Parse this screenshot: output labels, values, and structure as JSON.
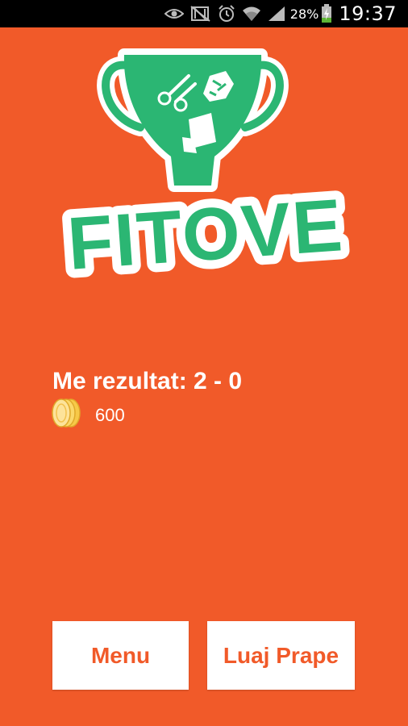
{
  "status_bar": {
    "battery_percent": "28%",
    "time": "19:37",
    "icons": [
      "eye-icon",
      "nfc-off-icon",
      "alarm-icon",
      "wifi-icon",
      "signal-icon",
      "battery-charging-icon"
    ]
  },
  "logo": {
    "text": "FITOVE",
    "colors": {
      "green": "#2bb673",
      "white": "#ffffff",
      "background": "#f15a29"
    },
    "icons": [
      "trophy-icon",
      "scissors-icon",
      "rock-icon",
      "paper-icon"
    ]
  },
  "result": {
    "label": "Me rezultat: 2 - 0"
  },
  "coins": {
    "icon": "coins-icon",
    "value": "600"
  },
  "buttons": {
    "menu": "Menu",
    "replay": "Luaj Prape"
  },
  "colors": {
    "accent": "#f15a29",
    "button_bg": "#ffffff",
    "text": "#ffffff"
  }
}
